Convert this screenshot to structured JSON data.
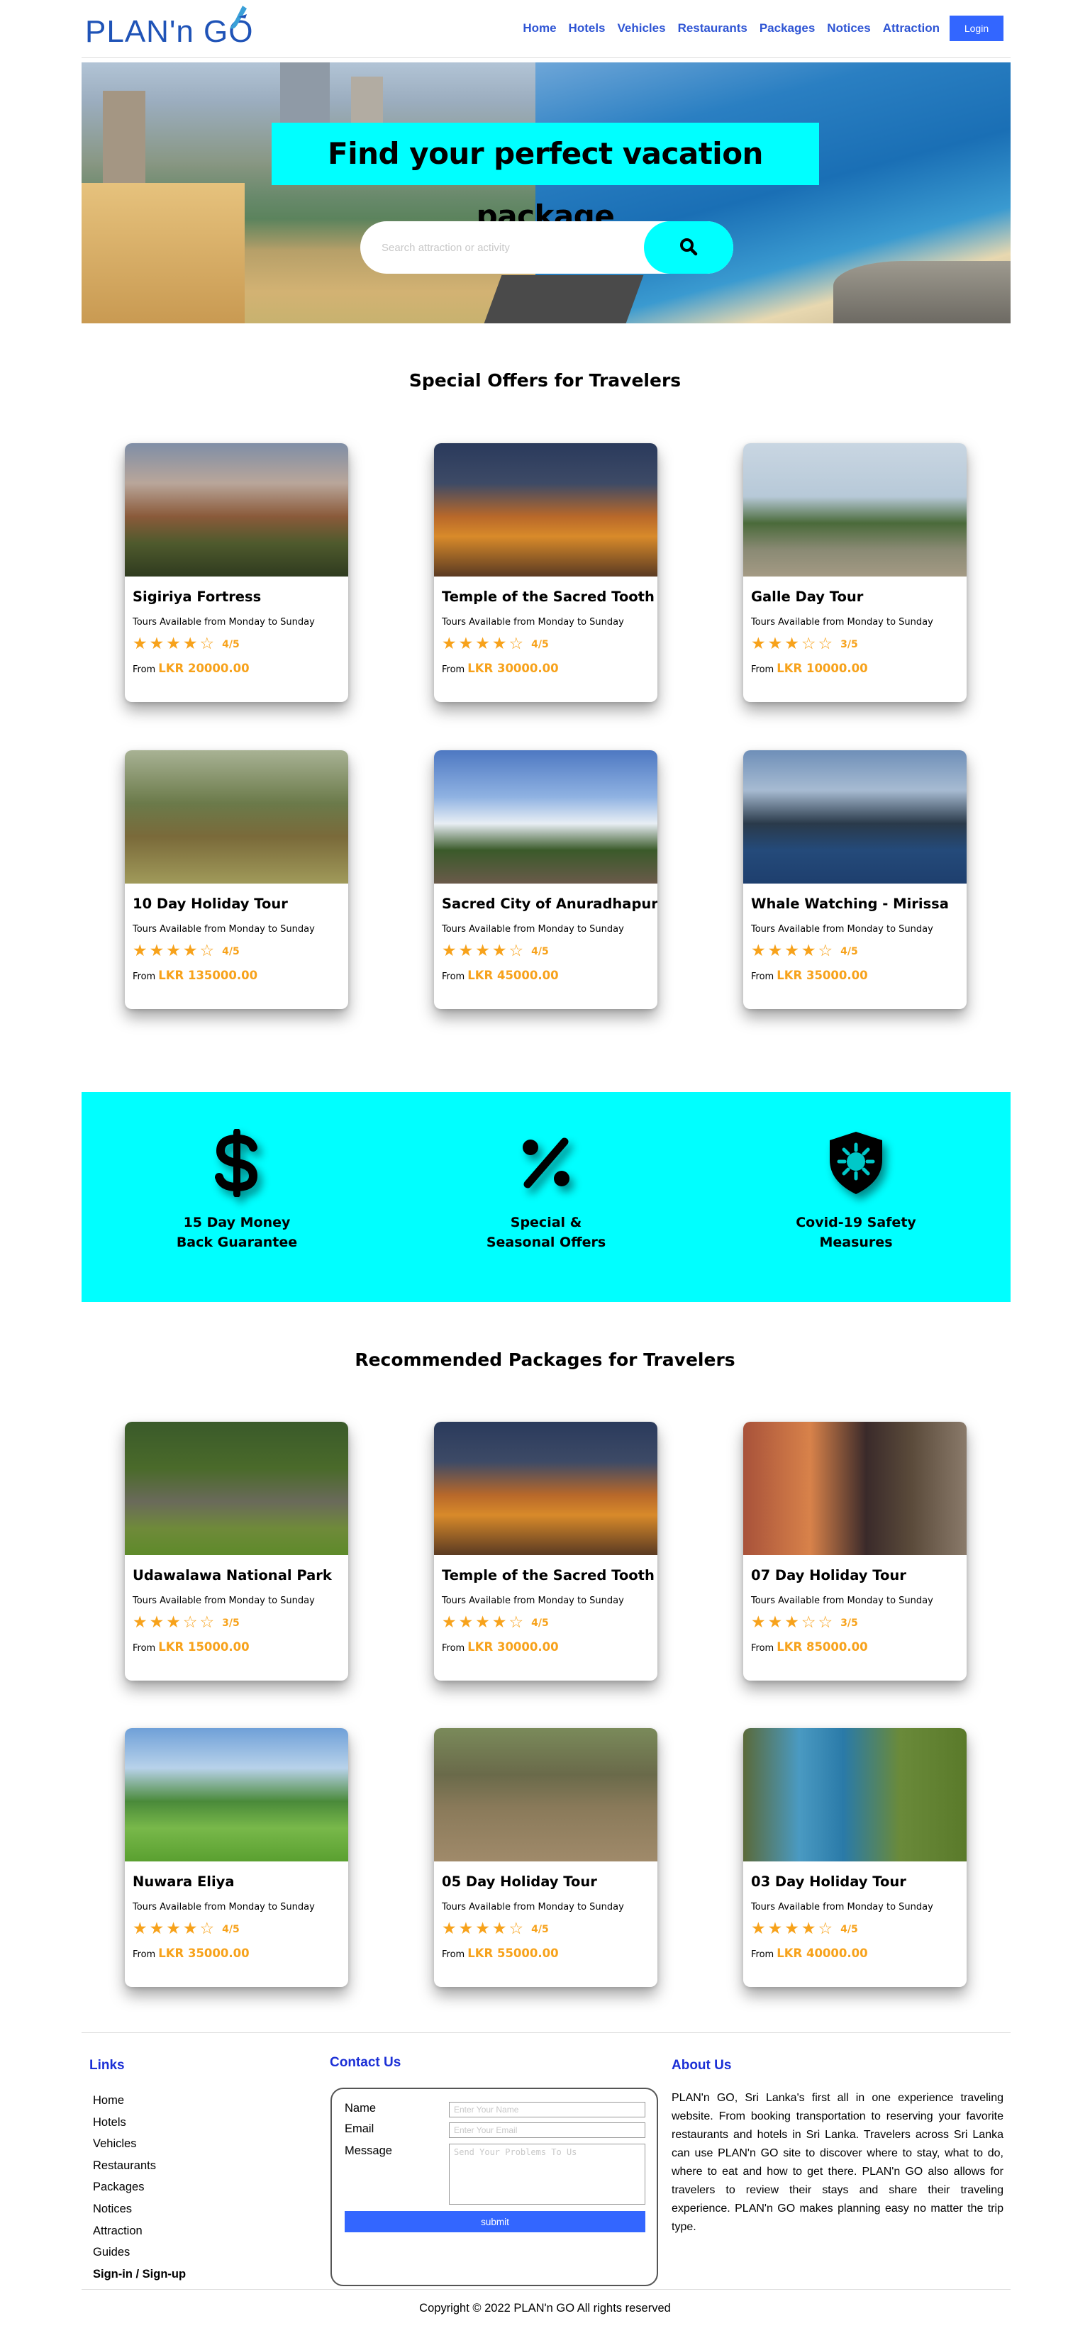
{
  "nav": {
    "logo_text": "PLAN'n GO",
    "items": [
      "Home",
      "Hotels",
      "Vehicles",
      "Restaurants",
      "Packages",
      "Notices",
      "Attraction"
    ],
    "login_label": "Login",
    "accent": "#2f55d4"
  },
  "hero": {
    "title": "Find your perfect vacation package",
    "search_placeholder": "Search attraction or activity",
    "search_icon": "search-icon",
    "title_bg": "#00ffff"
  },
  "special": {
    "title": "Special Offers for Travelers",
    "cards": [
      {
        "name": "Sigiriya Fortress",
        "sub": "Tours Available from Monday to Sunday",
        "stars": 4,
        "rating": "4/5",
        "from": "From",
        "price": "LKR 20000.00",
        "image": "sigiriya-rock"
      },
      {
        "name": "Temple of the Sacred Tooth",
        "sub": "Tours Available from Monday to Sunday",
        "stars": 4,
        "rating": "4/5",
        "from": "From",
        "price": "LKR 30000.00",
        "image": "temple-night"
      },
      {
        "name": "Galle Day Tour",
        "sub": "Tours Available from Monday to Sunday",
        "stars": 3,
        "rating": "3/5",
        "from": "From",
        "price": "LKR 10000.00",
        "image": "galle-lighthouse"
      },
      {
        "name": "10 Day Holiday Tour",
        "sub": "Tours Available from Monday to Sunday",
        "stars": 4,
        "rating": "4/5",
        "from": "From",
        "price": "LKR 135000.00",
        "image": "nine-arch-bridge"
      },
      {
        "name": "Sacred City of Anuradhapura",
        "sub": "Tours Available from Monday to Sunday",
        "stars": 4,
        "rating": "4/5",
        "from": "From",
        "price": "LKR 45000.00",
        "image": "stupa"
      },
      {
        "name": "Whale Watching - Mirissa",
        "sub": "Tours Available from Monday to Sunday",
        "stars": 4,
        "rating": "4/5",
        "from": "From",
        "price": "LKR 35000.00",
        "image": "whale"
      }
    ]
  },
  "features": [
    {
      "icon": "dollar-icon",
      "line1": "15 Day Money",
      "line2": "Back Guarantee"
    },
    {
      "icon": "percent-icon",
      "line1": "Special &",
      "line2": "Seasonal Offers"
    },
    {
      "icon": "virus-shield-icon",
      "line1": "Covid-19 Safety",
      "line2": "Measures"
    }
  ],
  "recommended": {
    "title": "Recommended Packages for Travelers",
    "cards": [
      {
        "name": "Udawalawa National Park",
        "sub": "Tours Available from Monday to Sunday",
        "stars": 3,
        "rating": "3/5",
        "from": "From",
        "price": "LKR 15000.00",
        "image": "elephants"
      },
      {
        "name": "Temple of the Sacred Tooth",
        "sub": "Tours Available from Monday to Sunday",
        "stars": 4,
        "rating": "4/5",
        "from": "From",
        "price": "LKR 30000.00",
        "image": "temple-night"
      },
      {
        "name": "07 Day Holiday Tour",
        "sub": "Tours Available from Monday to Sunday",
        "stars": 3,
        "rating": "3/5",
        "from": "From",
        "price": "LKR 85000.00",
        "image": "lady-lantern"
      },
      {
        "name": "Nuwara Eliya",
        "sub": "Tours Available from Monday to Sunday",
        "stars": 4,
        "rating": "4/5",
        "from": "From",
        "price": "LKR 35000.00",
        "image": "tea-hills"
      },
      {
        "name": "05 Day Holiday Tour",
        "sub": "Tours Available from Monday to Sunday",
        "stars": 4,
        "rating": "4/5",
        "from": "From",
        "price": "LKR 55000.00",
        "image": "ruins-steps"
      },
      {
        "name": "03 Day Holiday Tour",
        "sub": "Tours Available from Monday to Sunday",
        "stars": 4,
        "rating": "4/5",
        "from": "From",
        "price": "LKR 40000.00",
        "image": "blue-train"
      }
    ]
  },
  "footer": {
    "links_title": "Links",
    "links": [
      "Home",
      "Hotels",
      "Vehicles",
      "Restaurants",
      "Packages",
      "Notices",
      "Attraction",
      "Guides"
    ],
    "signin": "Sign-in / Sign-up",
    "contact_title": "Contact Us",
    "name_label": "Name",
    "name_placeholder": "Enter Your Name",
    "email_label": "Email",
    "email_placeholder": "Enter Your Email",
    "message_label": "Message",
    "message_placeholder": "Send Your Problems To Us",
    "submit_label": "submit",
    "about_title": "About Us",
    "about_text": "PLAN'n GO, Sri Lanka's first all in one experience traveling website. From booking transportation to reserving your favorite restaurants and hotels in Sri Lanka. Travelers across Sri Lanka can use PLAN'n GO site to discover where to stay, what to do, where to eat and how to get there. PLAN'n GO also allows for travelers to review their stays and share their traveling experience. PLAN'n GO makes planning easy no matter the trip type.",
    "copyright": "Copyright © 2022 PLAN'n GO All rights reserved"
  }
}
